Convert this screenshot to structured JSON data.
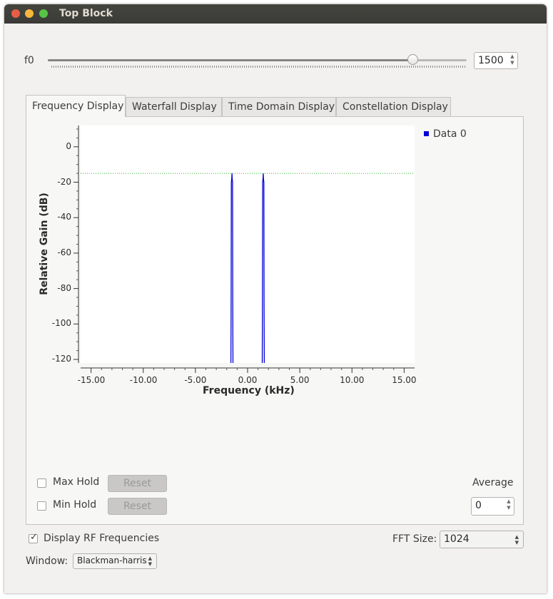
{
  "window": {
    "title": "Top Block"
  },
  "controls": {
    "f0": {
      "label": "f0",
      "slider_fraction": 0.87,
      "value": "1500"
    }
  },
  "tabs": [
    {
      "label": "Frequency Display",
      "active": true
    },
    {
      "label": "Waterfall Display",
      "active": false
    },
    {
      "label": "Time Domain Display",
      "active": false
    },
    {
      "label": "Constellation Display",
      "active": false
    }
  ],
  "chart_data": {
    "type": "line",
    "xlabel": "Frequency (kHz)",
    "ylabel": "Relative Gain (dB)",
    "xlim": [
      -16,
      16
    ],
    "ylim": [
      -122,
      12
    ],
    "x_ticks": [
      "-15.00",
      "-10.00",
      "-5.00",
      "0.00",
      "5.00",
      "10.00",
      "15.00"
    ],
    "y_ticks": [
      "0",
      "-20",
      "-40",
      "-60",
      "-80",
      "-100",
      "-120"
    ],
    "threshold_line_y": -15,
    "series": [
      {
        "name": "Data 0",
        "color": "#0000d8",
        "x": [
          -1.6,
          -1.58,
          -1.56,
          -1.52,
          -1.5,
          -1.48,
          -1.44,
          -1.42,
          -1.4,
          1.4,
          1.42,
          1.44,
          1.48,
          1.5,
          1.52,
          1.56,
          1.58,
          1.6
        ],
        "y": [
          -122,
          -90,
          -20,
          -18,
          -15,
          -18,
          -20,
          -90,
          -122,
          -122,
          -90,
          -20,
          -18,
          -15,
          -18,
          -20,
          -90,
          -122
        ]
      }
    ],
    "legend": [
      "Data 0"
    ],
    "legend_position": "top-right"
  },
  "panel_controls": {
    "max_hold": {
      "label": "Max Hold",
      "checked": false,
      "reset_label": "Reset"
    },
    "min_hold": {
      "label": "Min Hold",
      "checked": false,
      "reset_label": "Reset"
    },
    "average": {
      "label": "Average",
      "value": "0"
    }
  },
  "bottom": {
    "display_rf": {
      "label": "Display RF Frequencies",
      "checked": true,
      "mark": "✓"
    },
    "fft_size": {
      "label": "FFT Size:",
      "value": "1024"
    },
    "window": {
      "label": "Window:",
      "value": "Blackman-harris"
    }
  }
}
